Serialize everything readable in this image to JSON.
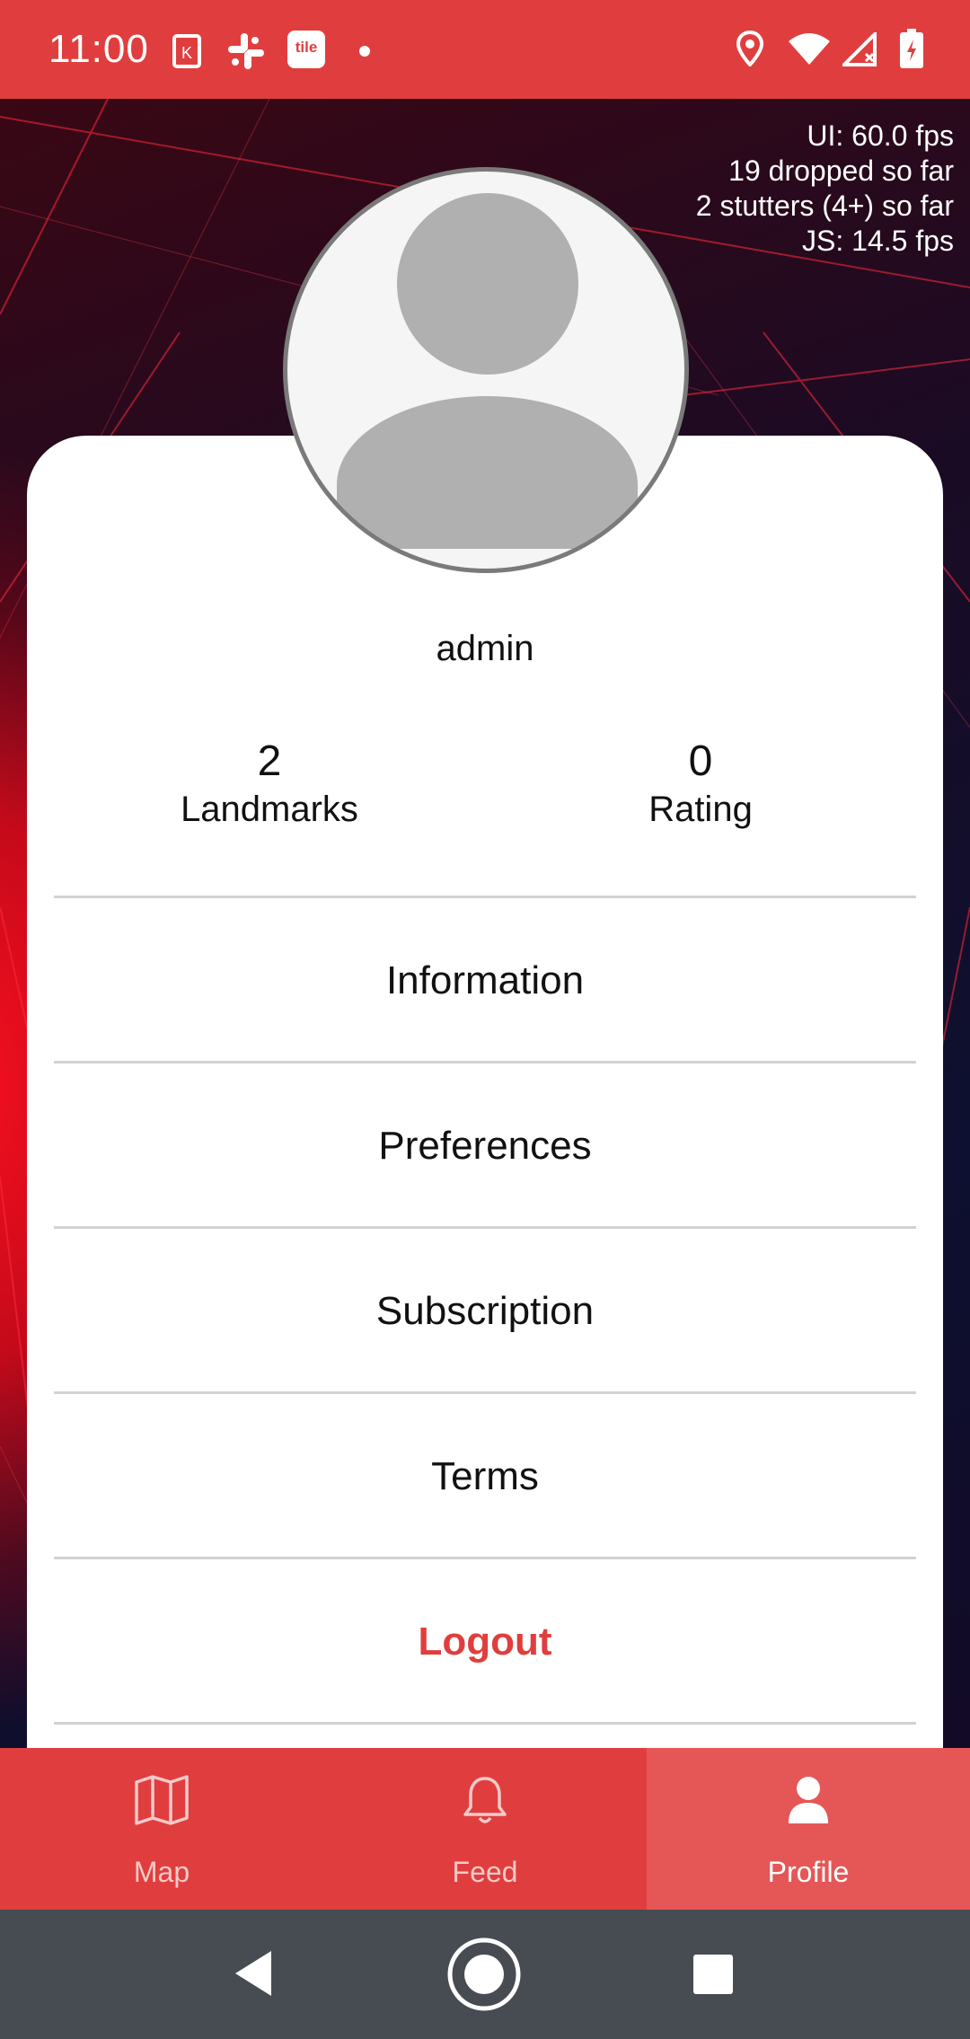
{
  "status_bar": {
    "time": "11:00",
    "notification_icons": [
      "kindle-icon",
      "slack-icon",
      "tile-icon",
      "dot-icon"
    ],
    "tile_label": "tile",
    "system_icons": [
      "location-icon",
      "wifi-icon",
      "signal-icon",
      "battery-icon"
    ]
  },
  "fps_overlay": {
    "line1": "UI: 60.0 fps",
    "line2": "19 dropped so far",
    "line3": "2 stutters (4+) so far",
    "line4": "JS: 14.5 fps"
  },
  "profile": {
    "username": "admin",
    "stats": [
      {
        "value": "2",
        "label": "Landmarks"
      },
      {
        "value": "0",
        "label": "Rating"
      }
    ]
  },
  "menu": {
    "items": [
      {
        "label": "Information"
      },
      {
        "label": "Preferences"
      },
      {
        "label": "Subscription"
      },
      {
        "label": "Terms"
      },
      {
        "label": "Logout"
      }
    ]
  },
  "tabs": [
    {
      "label": "Map",
      "icon": "map-icon",
      "active": false
    },
    {
      "label": "Feed",
      "icon": "bell-icon",
      "active": false
    },
    {
      "label": "Profile",
      "icon": "person-icon",
      "active": true
    }
  ],
  "colors": {
    "accent": "#e03e3e",
    "active_tab": "#e55757",
    "logout_text": "#e03e3e",
    "nav_bar": "#464c52"
  }
}
